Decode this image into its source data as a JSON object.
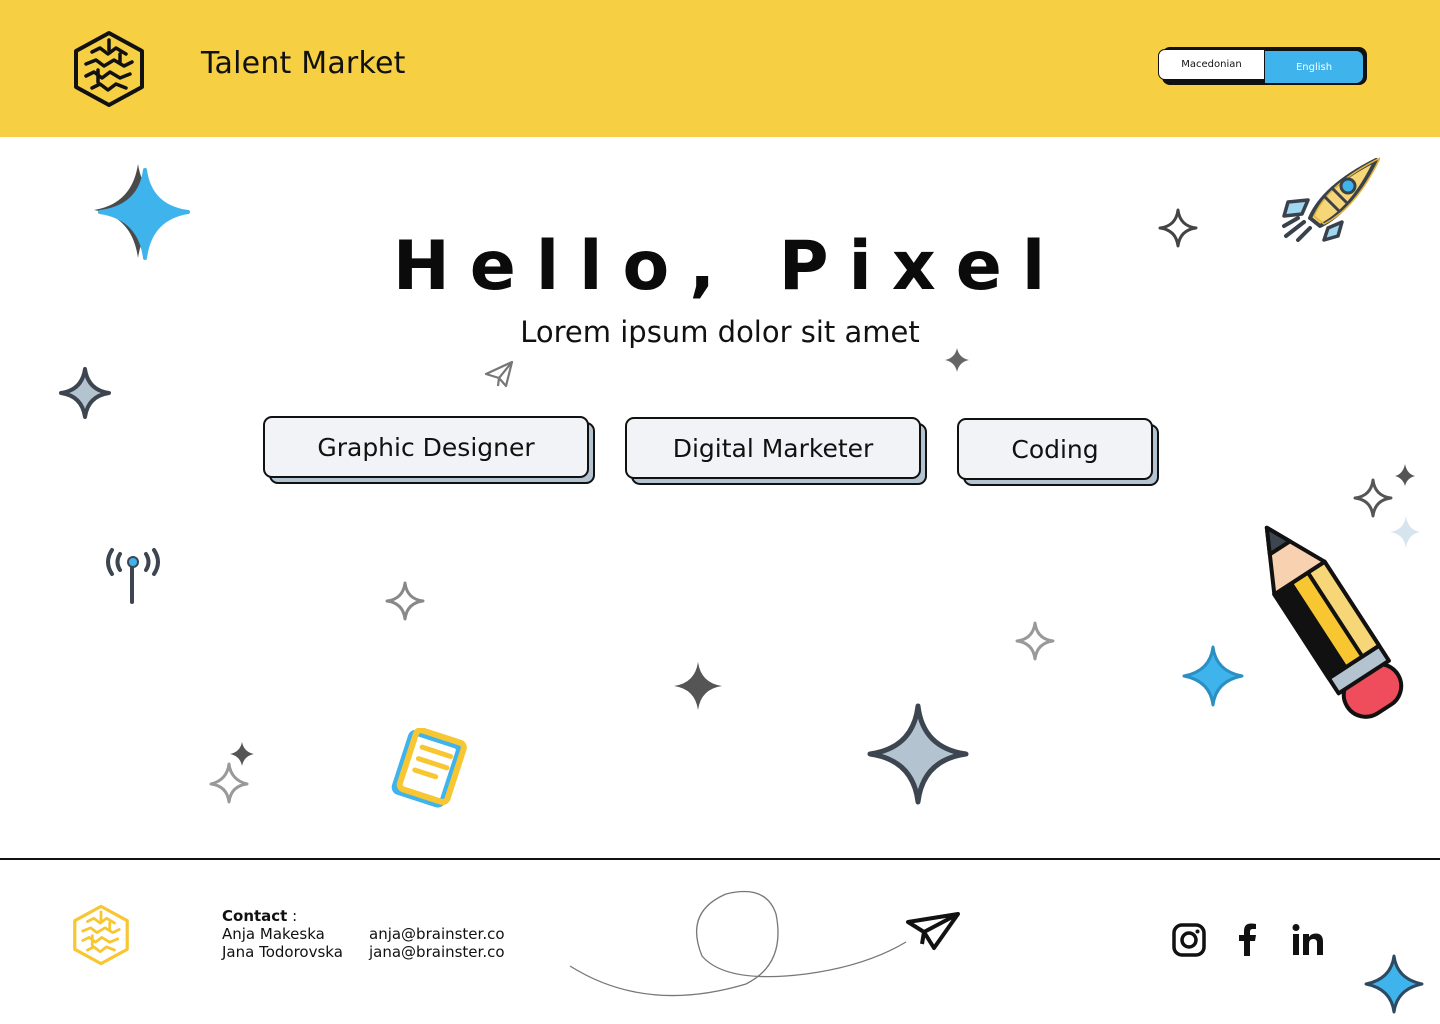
{
  "header": {
    "title": "Talent Market",
    "languages": {
      "macedonian": "Macedonian",
      "english": "English",
      "active": "English"
    }
  },
  "hero": {
    "title": "Hello, Pixel",
    "subtitle": "Lorem ipsum dolor sit amet"
  },
  "categories": [
    {
      "label": "Graphic Designer"
    },
    {
      "label": "Digital Marketer"
    },
    {
      "label": "Coding"
    }
  ],
  "footer": {
    "contact_label": "Contact",
    "contact_sep": " :",
    "contacts": [
      {
        "name": "Anja Makeska",
        "email": "anja@brainster.co"
      },
      {
        "name": "Jana Todorovska",
        "email": "jana@brainster.co"
      }
    ],
    "social": [
      "instagram-icon",
      "facebook-icon",
      "linkedin-icon"
    ]
  },
  "colors": {
    "header_bg": "#f7cf42",
    "accent_blue": "#3eb3ec",
    "button_bg": "#f2f3f6",
    "button_shadow": "#b3c3d0",
    "pencil_yellow": "#f7c631",
    "eraser_red": "#ef4d5c"
  }
}
